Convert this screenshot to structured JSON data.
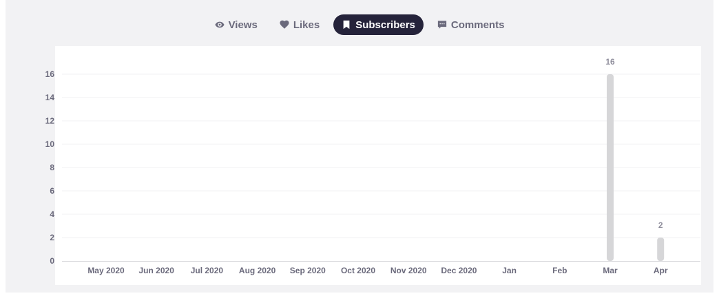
{
  "tabs": [
    {
      "label": "Views",
      "icon": "eye-icon",
      "active": false
    },
    {
      "label": "Likes",
      "icon": "heart-icon",
      "active": false
    },
    {
      "label": "Subscribers",
      "icon": "bookmark-icon",
      "active": true
    },
    {
      "label": "Comments",
      "icon": "comment-icon",
      "active": false
    }
  ],
  "colors": {
    "active_tab_bg": "#25233a",
    "tab_text": "#6b6a7c",
    "bar": "#d6d6d8",
    "axis_text": "#6b6a7c",
    "panel_bg": "#f2f2f4"
  },
  "chart_data": {
    "type": "bar",
    "categories": [
      "May 2020",
      "Jun 2020",
      "Jul 2020",
      "Aug 2020",
      "Sep 2020",
      "Oct 2020",
      "Nov 2020",
      "Dec 2020",
      "Jan",
      "Feb",
      "Mar",
      "Apr"
    ],
    "values": [
      0,
      0,
      0,
      0,
      0,
      0,
      0,
      0,
      0,
      0,
      16,
      2
    ],
    "data_labels": [
      "",
      "",
      "",
      "",
      "",
      "",
      "",
      "",
      "",
      "",
      "16",
      "2"
    ],
    "y_ticks": [
      "0",
      "2",
      "4",
      "6",
      "8",
      "10",
      "12",
      "14",
      "16"
    ],
    "ylim": [
      0,
      16
    ],
    "grid": true,
    "legend": false
  }
}
